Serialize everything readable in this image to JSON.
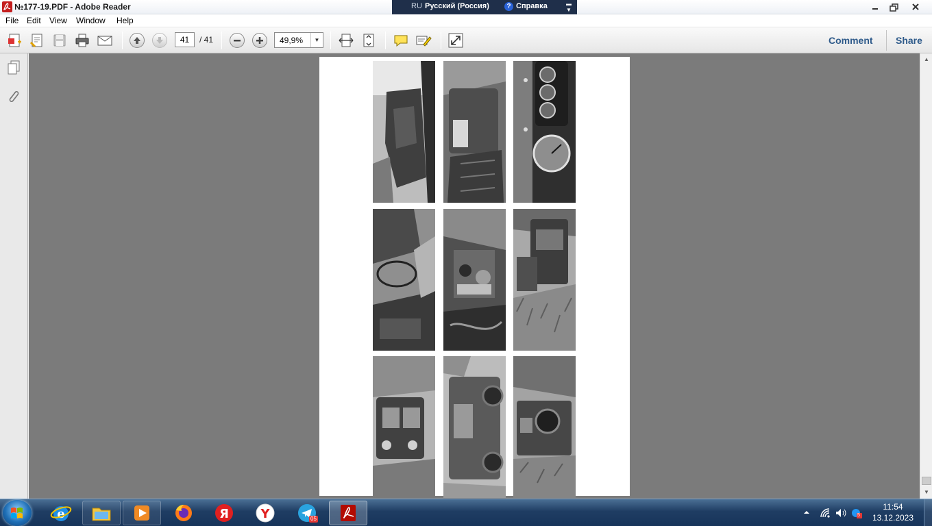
{
  "window": {
    "title": "№177-19.PDF - Adobe Reader"
  },
  "language_bar": {
    "code": "RU",
    "name": "Русский (Россия)",
    "help": "Справка"
  },
  "menu": {
    "items": [
      "File",
      "Edit",
      "View",
      "Window",
      "Help"
    ]
  },
  "toolbar": {
    "page_current": "41",
    "page_total": "/ 41",
    "zoom": "49,9%",
    "comment_label": "Comment",
    "share_label": "Share"
  },
  "clock": {
    "time": "11:54",
    "date": "13.12.2023"
  },
  "tray": {
    "badge_count": "5"
  },
  "taskbar": {
    "telegram_badge": "05"
  },
  "colors": {
    "accent_link": "#2e5a8a",
    "doc_background": "#7b7b7b",
    "taskbar": "#1f3d63",
    "language_bar": "#1f2f4a"
  },
  "icons": {
    "app": "adobe-reader-icon",
    "create": "create-pdf-icon",
    "edit": "edit-file-icon",
    "save": "save-icon",
    "print": "print-icon",
    "email": "email-icon",
    "prev": "previous-page-icon",
    "next": "next-page-icon",
    "zoom_out": "zoom-out-icon",
    "zoom_in": "zoom-in-icon",
    "fit_page": "fit-page-icon",
    "fit_width": "fit-width-icon",
    "sticky_note": "sticky-note-icon",
    "highlight": "highlight-icon",
    "fullscreen": "full-screen-icon"
  }
}
